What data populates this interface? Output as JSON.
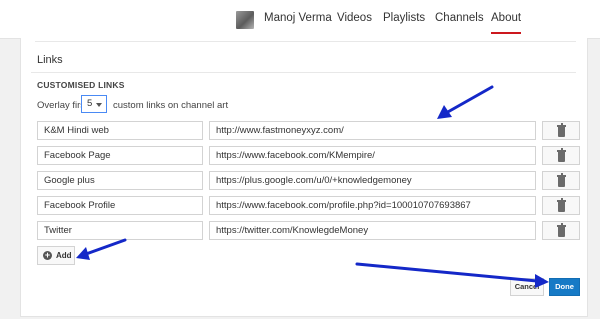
{
  "nav": {
    "channel_name": "Manoj Verma",
    "tabs": [
      {
        "label": "Videos"
      },
      {
        "label": "Playlists"
      },
      {
        "label": "Channels"
      },
      {
        "label": "About",
        "active": true
      }
    ]
  },
  "section": {
    "title": "Links",
    "custom_title": "CUSTOMISED LINKS",
    "overlay_prefix": "Overlay first",
    "overlay_value": "5",
    "overlay_suffix": "custom links on channel art"
  },
  "links": [
    {
      "title": "K&M Hindi web",
      "url": "http://www.fastmoneyxyz.com/"
    },
    {
      "title": "Facebook Page",
      "url": "https://www.facebook.com/KMempire/"
    },
    {
      "title": "Google plus",
      "url": "https://plus.google.com/u/0/+knowledgemoney"
    },
    {
      "title": "Facebook Profile",
      "url": "https://www.facebook.com/profile.php?id=100010707693867"
    },
    {
      "title": "Twitter",
      "url": "https://twitter.com/KnowlegdeMoney"
    }
  ],
  "buttons": {
    "add": "Add",
    "cancel": "Cancel",
    "done": "Done"
  },
  "colors": {
    "annotation_arrow": "#1428c8",
    "primary_button": "#167ac6",
    "active_tab_underline": "#cc181e"
  }
}
